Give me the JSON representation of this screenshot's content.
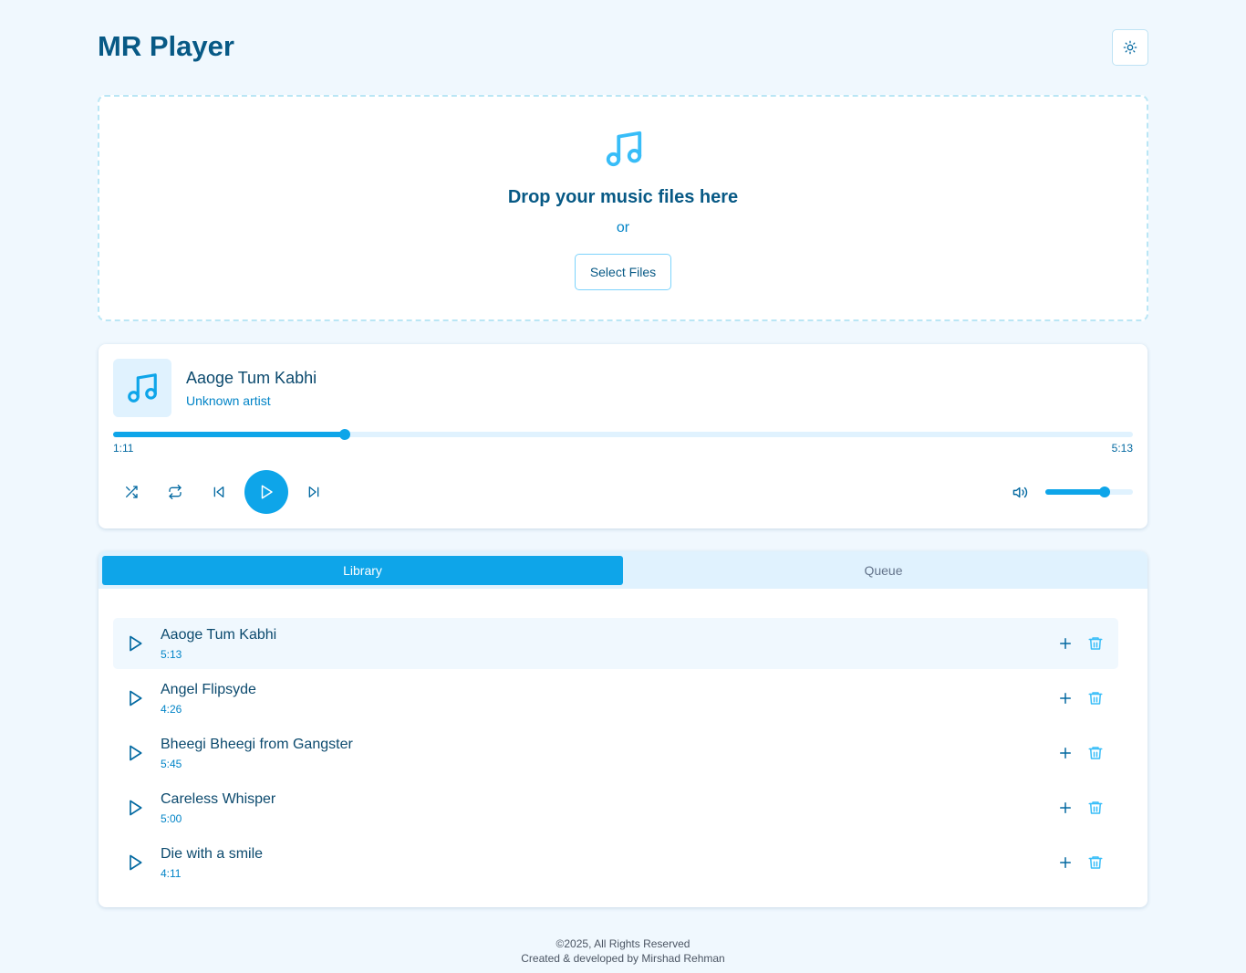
{
  "app": {
    "title": "MR Player"
  },
  "dropzone": {
    "title": "Drop your music files here",
    "or_text": "or",
    "select_label": "Select Files"
  },
  "now_playing": {
    "title": "Aaoge Tum Kabhi",
    "artist": "Unknown artist",
    "current_time": "1:11",
    "total_time": "5:13",
    "progress_fraction": 0.227,
    "volume_fraction": 0.68
  },
  "tabs": [
    {
      "label": "Library",
      "active": true
    },
    {
      "label": "Queue",
      "active": false
    }
  ],
  "library": [
    {
      "title": "Aaoge Tum Kabhi",
      "duration": "5:13",
      "current": true
    },
    {
      "title": "Angel Flipsyde",
      "duration": "4:26",
      "current": false
    },
    {
      "title": "Bheegi Bheegi from Gangster",
      "duration": "5:45",
      "current": false
    },
    {
      "title": "Careless Whisper",
      "duration": "5:00",
      "current": false
    },
    {
      "title": "Die with a smile",
      "duration": "4:11",
      "current": false
    }
  ],
  "footer": {
    "copyright": "©2025, All Rights Reserved",
    "credit": "Created & developed by Mirshad Rehman"
  },
  "icons": {
    "theme": "sun-icon",
    "drop": "music-note-icon",
    "shuffle": "shuffle-icon",
    "repeat": "repeat-icon",
    "previous": "skip-back-icon",
    "play": "play-icon",
    "next": "skip-forward-icon",
    "volume": "volume-icon",
    "add": "plus-icon",
    "delete": "trash-icon"
  },
  "colors": {
    "accent": "#0ea5e9",
    "heading": "#075985",
    "page_background": "#f0f8fe"
  }
}
